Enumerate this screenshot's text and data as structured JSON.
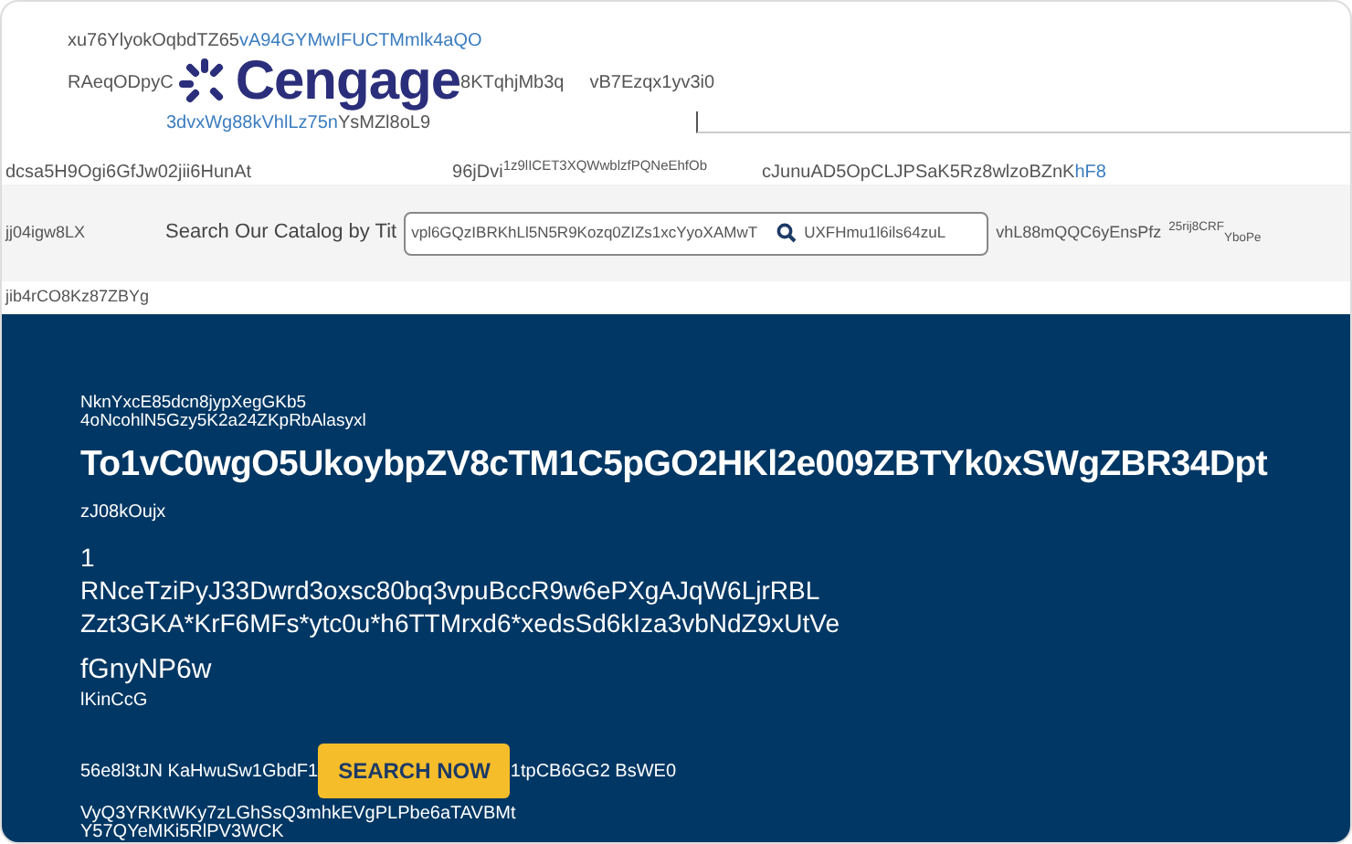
{
  "header": {
    "tagline": {
      "plain": "xu76YlyokOqbdTZ65",
      "link": "vA94GYMwIFUCTMmlk4aQO"
    },
    "left_text": "RAeqODpyC",
    "logo": "Cengage",
    "right_texts": [
      "8KTqhjMb3q",
      "vB7Ezqx1yv3i0"
    ],
    "subline": {
      "link": "3dvxWg88kVhlLz75n",
      "plain": "YsMZl8oL9"
    }
  },
  "nav": {
    "left_text": "dcsa5H9Ogi6GfJw02jii6HunAt",
    "middle_text": "96jDvi",
    "middle_sup": "1z9lICET3XQWwblzfPQNeEhfOb",
    "right_text": "cJunuAD5OpCLJPSaK5Rz8wlzoBZnK",
    "right_link": "hF8"
  },
  "search": {
    "left_text": "jj04igw8LX",
    "label": "Search Our Catalog by Tit",
    "value": "vpl6GQzIBRKhLl5N5R9Kozq0ZIZs1xcYyoXAMwT",
    "after_icon": "UXFHmu1l6ils64zuL",
    "extra": "vhL88mQQC6yEnsPfz",
    "sup": "25rij8CRF",
    "sub": "YboPe"
  },
  "below_text": "jib4rCO8Kz87ZBYg",
  "hero": {
    "eyebrow": [
      "NknYxcE85dcn8jypXegGKb5",
      "4oNcohlN5Gzy5K2a24ZKpRbAlasyxl"
    ],
    "title": "To1vC0wgO5UkoybpZV8cTM1C5pGO2HKl2e009ZBTYk0xSWgZBR34Dpt",
    "subtitle": "zJ08kOujx",
    "number": "1",
    "body": [
      "RNceTziPyJ33Dwrd3oxsc80bq3vpuBccR9w6ePXgAJqW6LjrRBL",
      "Zzt3GKA*KrF6MFs*ytc0u*h6TTMrxd6*xedsSd6kIza3vbNdZ9xUtVe"
    ],
    "heading": "fGnyNP6w",
    "caption": "lKinCcG",
    "before_button": "56e8l3tJN KaHwuSw1GbdF1",
    "button": "SEARCH NOW",
    "after_button": "1tpCB6GG2 BsWE0",
    "footer_lines": [
      "VyQ3YRKtWKy7zLGhSsQ3mhkEVgPLPbe6aTAVBMt",
      "Y57QYeMKi5RlPV3WCK"
    ]
  }
}
